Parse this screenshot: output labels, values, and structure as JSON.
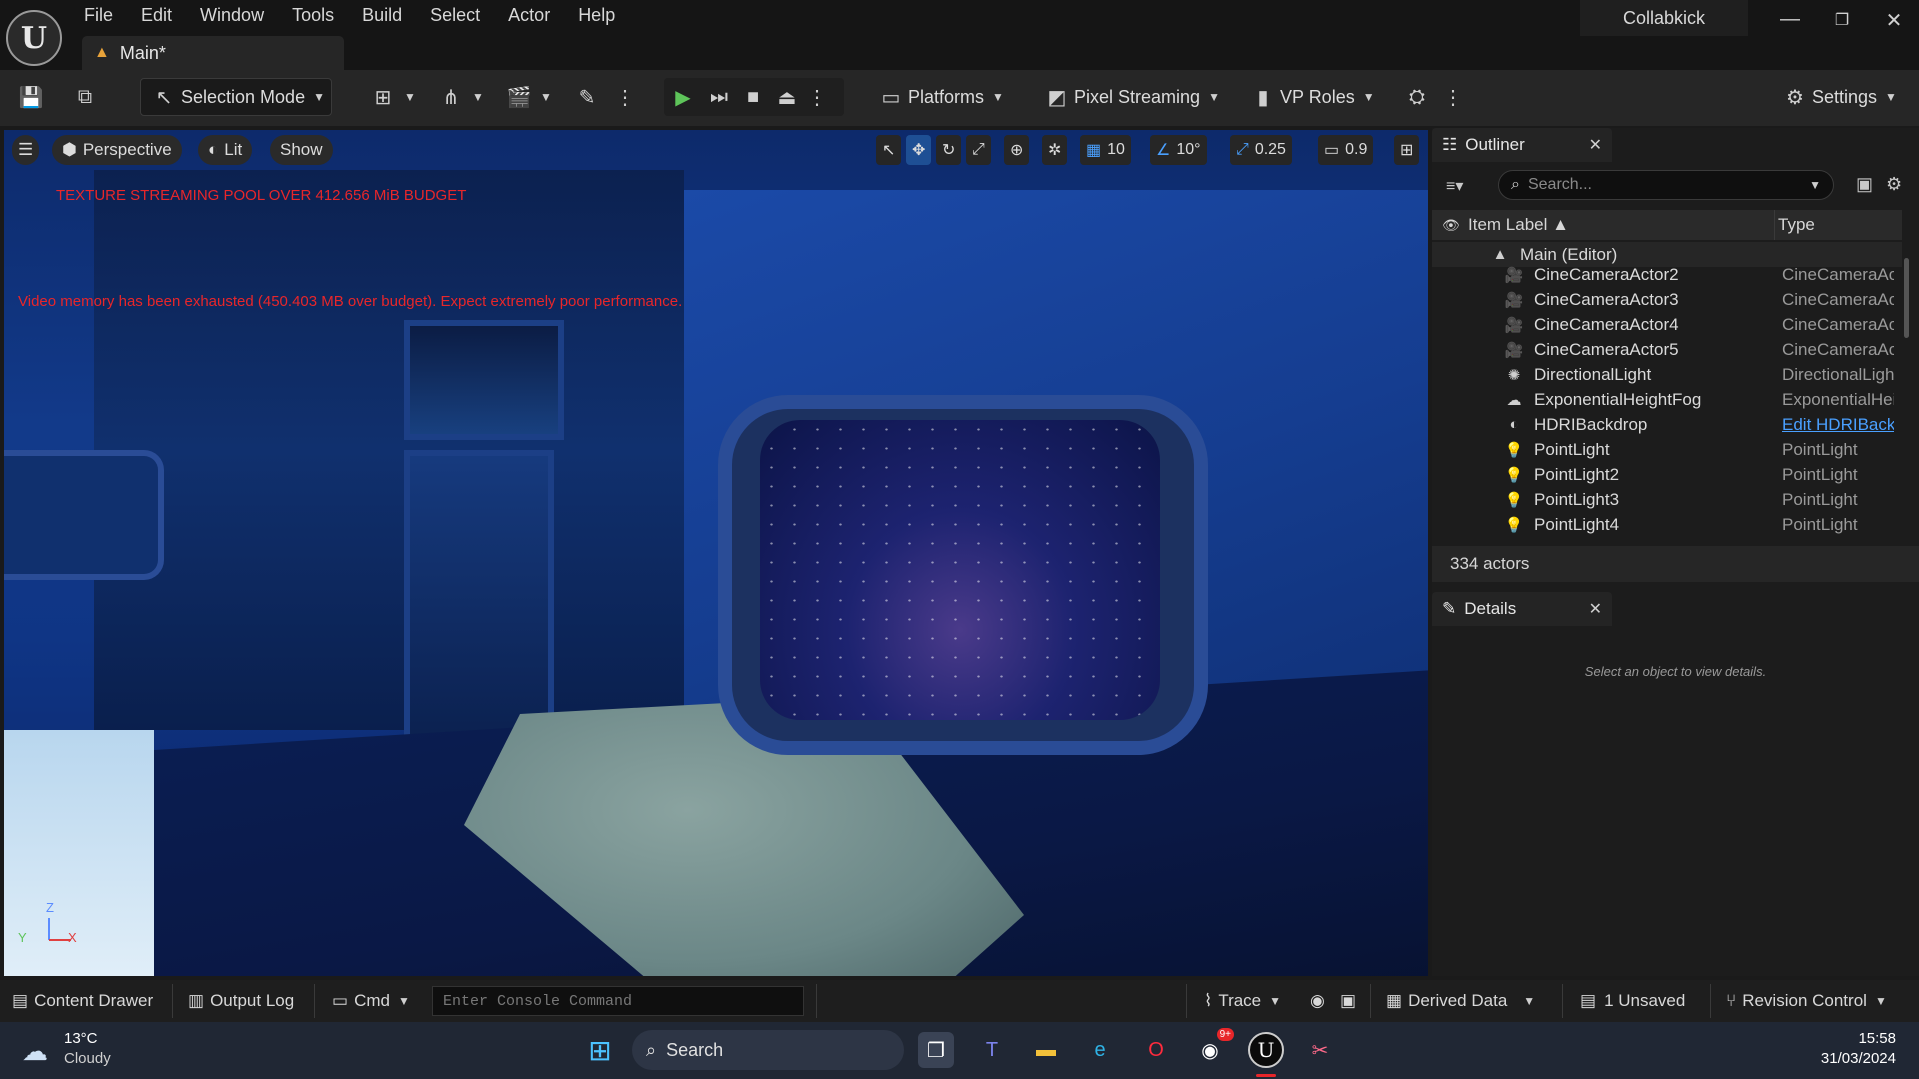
{
  "app": {
    "project_name": "Collabkick",
    "document_tab": "Main*"
  },
  "menu": [
    "File",
    "Edit",
    "Window",
    "Tools",
    "Build",
    "Select",
    "Actor",
    "Help"
  ],
  "toolbar": {
    "selection_mode": "Selection Mode",
    "platforms": "Platforms",
    "pixel_streaming": "Pixel Streaming",
    "vp_roles": "VP Roles",
    "settings": "Settings"
  },
  "viewport": {
    "perspective": "Perspective",
    "lit": "Lit",
    "show": "Show",
    "grid_snap": "10",
    "rotation_snap": "10°",
    "scale_snap": "0.25",
    "camera_speed": "0.9",
    "warning_texture": "TEXTURE STREAMING POOL OVER 412.656 MiB BUDGET",
    "warning_memory": "Video memory has been exhausted (450.403 MB over budget). Expect extremely poor performance.",
    "axis_z": "Z",
    "axis_y": "Y",
    "axis_x": "X"
  },
  "outliner": {
    "title": "Outliner",
    "search_placeholder": "Search...",
    "col_label": "Item Label ▲",
    "col_type": "Type",
    "root": "Main (Editor)",
    "items": [
      {
        "label": "CineCameraActor2",
        "type": "CineCameraAc",
        "icon": "camera-icon"
      },
      {
        "label": "CineCameraActor3",
        "type": "CineCameraAc",
        "icon": "camera-icon"
      },
      {
        "label": "CineCameraActor4",
        "type": "CineCameraAc",
        "icon": "camera-icon"
      },
      {
        "label": "CineCameraActor5",
        "type": "CineCameraAc",
        "icon": "camera-icon"
      },
      {
        "label": "DirectionalLight",
        "type": "DirectionalLigh",
        "icon": "sun-icon"
      },
      {
        "label": "ExponentialHeightFog",
        "type": "ExponentialHei",
        "icon": "fog-icon"
      },
      {
        "label": "HDRIBackdrop",
        "type": "Edit HDRIBack",
        "icon": "sphere-icon"
      },
      {
        "label": "PointLight",
        "type": "PointLight",
        "icon": "bulb-icon"
      },
      {
        "label": "PointLight2",
        "type": "PointLight",
        "icon": "bulb-icon"
      },
      {
        "label": "PointLight3",
        "type": "PointLight",
        "icon": "bulb-icon"
      },
      {
        "label": "PointLight4",
        "type": "PointLight",
        "icon": "bulb-icon"
      }
    ],
    "actor_count": "334 actors"
  },
  "details": {
    "title": "Details",
    "empty_message": "Select an object to view details."
  },
  "statusbar": {
    "content_drawer": "Content Drawer",
    "output_log": "Output Log",
    "cmd": "Cmd",
    "console_placeholder": "Enter Console Command",
    "trace": "Trace",
    "derived_data": "Derived Data",
    "unsaved": "1 Unsaved",
    "revision_control": "Revision Control"
  },
  "taskbar": {
    "temperature": "13°C",
    "weather": "Cloudy",
    "search": "Search",
    "time": "15:58",
    "date": "31/03/2024",
    "discord_badge": "9+"
  },
  "colors": {
    "accent_green": "#5ec45a",
    "warning_red": "#e8262a",
    "link_blue": "#4aa0ff"
  }
}
